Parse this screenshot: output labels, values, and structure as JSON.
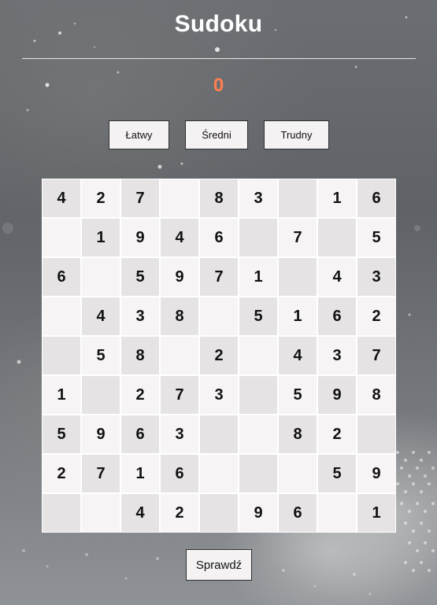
{
  "title": "Sudoku",
  "score": "0",
  "difficulty": {
    "easy_label": "Łatwy",
    "medium_label": "Średni",
    "hard_label": "Trudny"
  },
  "check_label": "Sprawdź",
  "colors": {
    "score": "#ff7f50",
    "cell_light": "#f7f4f5",
    "cell_dark": "#e6e3e4"
  },
  "board": [
    [
      "4",
      "2",
      "7",
      "",
      "8",
      "3",
      "",
      "1",
      "6"
    ],
    [
      "",
      "1",
      "9",
      "4",
      "6",
      "",
      "7",
      "",
      "5"
    ],
    [
      "6",
      "",
      "5",
      "9",
      "7",
      "1",
      "",
      "4",
      "3"
    ],
    [
      "",
      "4",
      "3",
      "8",
      "",
      "5",
      "1",
      "6",
      "2"
    ],
    [
      "",
      "5",
      "8",
      "",
      "2",
      "",
      "4",
      "3",
      "7"
    ],
    [
      "1",
      "",
      "2",
      "7",
      "3",
      "",
      "5",
      "9",
      "8"
    ],
    [
      "5",
      "9",
      "6",
      "3",
      "",
      "",
      "8",
      "2",
      ""
    ],
    [
      "2",
      "7",
      "1",
      "6",
      "",
      "",
      "",
      "5",
      "9"
    ],
    [
      "",
      "",
      "4",
      "2",
      "",
      "9",
      "6",
      "",
      "1"
    ]
  ]
}
